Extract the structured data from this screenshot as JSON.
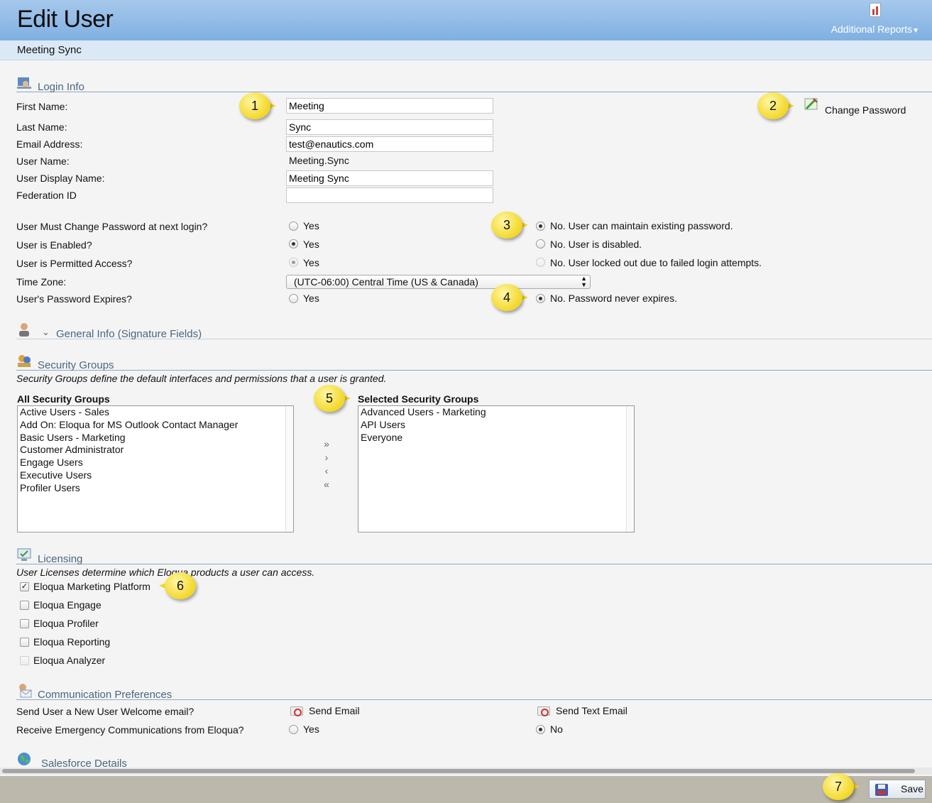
{
  "header": {
    "title": "Edit User",
    "reports_label": "Additional Reports"
  },
  "subheader": {
    "name": "Meeting Sync"
  },
  "login_info": {
    "title": "Login Info",
    "change_password": "Change Password",
    "first_name": {
      "label": "First Name:",
      "value": "Meeting"
    },
    "last_name": {
      "label": "Last Name:",
      "value": "Sync"
    },
    "email": {
      "label": "Email Address:",
      "value": "test@enautics.com"
    },
    "user_name": {
      "label": "User Name:",
      "value": "Meeting.Sync"
    },
    "display_name": {
      "label": "User Display Name:",
      "value": "Meeting Sync"
    },
    "federation_id": {
      "label": "Federation ID",
      "value": ""
    },
    "must_change": {
      "label": "User Must Change Password at next login?",
      "yes": "Yes",
      "no": "No. User can maintain existing password."
    },
    "enabled": {
      "label": "User is Enabled?",
      "yes": "Yes",
      "no": "No. User is disabled."
    },
    "permitted": {
      "label": "User is Permitted Access?",
      "yes": "Yes",
      "no": "No. User locked out due to failed login attempts."
    },
    "timezone": {
      "label": "Time Zone:",
      "value": "(UTC-06:00) Central Time (US & Canada)"
    },
    "expires": {
      "label": "User's Password Expires?",
      "yes": "Yes",
      "no": "No. Password never expires."
    }
  },
  "general_info": {
    "title": "General Info (Signature Fields)"
  },
  "security_groups": {
    "title": "Security Groups",
    "description": "Security Groups define the default interfaces and permissions that a user is granted.",
    "all_label": "All Security Groups",
    "selected_label": "Selected Security Groups",
    "all": [
      "Active Users - Sales",
      "Add On: Eloqua for MS Outlook Contact Manager",
      "Basic Users - Marketing",
      "Customer Administrator",
      "Engage Users",
      "Executive Users",
      "Profiler Users"
    ],
    "selected": [
      "Advanced Users - Marketing",
      "API Users",
      "Everyone"
    ],
    "move_all_right": "»",
    "move_right": "›",
    "move_left": "‹",
    "move_all_left": "«"
  },
  "licensing": {
    "title": "Licensing",
    "description": "User Licenses determine which Eloqua products a user can access.",
    "items": [
      {
        "label": "Eloqua Marketing Platform",
        "checked": true
      },
      {
        "label": "Eloqua Engage",
        "checked": false
      },
      {
        "label": "Eloqua Profiler",
        "checked": false
      },
      {
        "label": "Eloqua Reporting",
        "checked": false
      },
      {
        "label": "Eloqua Analyzer",
        "checked": false
      }
    ]
  },
  "communication": {
    "title": "Communication Preferences",
    "welcome_label": "Send User a New User Welcome email?",
    "send_email": "Send Email",
    "send_text_email": "Send Text Email",
    "emergency_label": "Receive Emergency Communications from Eloqua?",
    "yes": "Yes",
    "no": "No"
  },
  "salesforce": {
    "title": "Salesforce Details"
  },
  "footer": {
    "save": "Save"
  },
  "callouts": [
    "1",
    "2",
    "3",
    "4",
    "5",
    "6",
    "7"
  ],
  "colors": {
    "header_blue": "#7fb0e2",
    "section_title": "#4a6680",
    "callout_yellow": "#f3d725",
    "footer": "#bdb8ac"
  }
}
